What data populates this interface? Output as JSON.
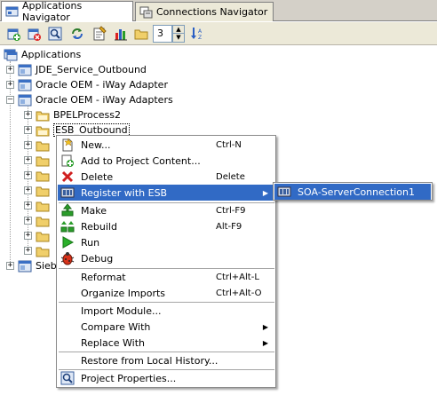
{
  "tabs": [
    {
      "label": "Applications Navigator",
      "active": true
    },
    {
      "label": "Connections Navigator",
      "active": false
    }
  ],
  "toolbar": {
    "spinner_value": "3",
    "icons": [
      "new-application-icon",
      "delete-icon",
      "search-icon",
      "refresh-icon",
      "properties-icon",
      "chart-icon",
      "folder-icon",
      "sort-icon"
    ]
  },
  "tree": {
    "root_label": "Applications",
    "items": [
      {
        "label": "JDE_Service_Outbound",
        "expanded": false
      },
      {
        "label": "Oracle OEM - iWay Adapter",
        "expanded": false
      },
      {
        "label": "Oracle OEM - iWay Adapters",
        "expanded": true
      }
    ],
    "children": [
      {
        "label": "BPELProcess2"
      },
      {
        "label": "ESB_Outbound"
      }
    ],
    "truncated_bottom_label": "Sieb"
  },
  "context_menu": {
    "items": [
      {
        "label": "New...",
        "accel": "Ctrl-N",
        "icon": "new-icon"
      },
      {
        "label": "Add to Project Content...",
        "accel": "",
        "icon": "add-icon"
      },
      {
        "label": "Delete",
        "accel": "Delete",
        "icon": "delete-x-icon"
      },
      {
        "label": "Register with ESB",
        "accel": "",
        "icon": "register-esb-icon",
        "submenu": true,
        "highlighted": true
      },
      {
        "label": "Make",
        "accel": "Ctrl-F9",
        "icon": "make-icon"
      },
      {
        "label": "Rebuild",
        "accel": "Alt-F9",
        "icon": "rebuild-icon"
      },
      {
        "label": "Run",
        "accel": "",
        "icon": "run-icon"
      },
      {
        "label": "Debug",
        "accel": "",
        "icon": "debug-icon"
      },
      {
        "label": "Reformat",
        "accel": "Ctrl+Alt-L",
        "icon": ""
      },
      {
        "label": "Organize Imports",
        "accel": "Ctrl+Alt-O",
        "icon": ""
      },
      {
        "label": "Import Module...",
        "accel": "",
        "icon": ""
      },
      {
        "label": "Compare With",
        "accel": "",
        "icon": "",
        "submenu": true
      },
      {
        "label": "Replace With",
        "accel": "",
        "icon": "",
        "submenu": true
      },
      {
        "label": "Restore from Local History...",
        "accel": "",
        "icon": ""
      },
      {
        "label": "Project Properties...",
        "accel": "",
        "icon": "properties-icon"
      }
    ]
  },
  "submenu": {
    "items": [
      {
        "label": "SOA-ServerConnection1",
        "icon": "server-connection-icon",
        "highlighted": true
      }
    ]
  },
  "colors": {
    "highlight": "#316ac5",
    "toolbar_bg": "#ece9d8",
    "folder": "#e8c460"
  }
}
